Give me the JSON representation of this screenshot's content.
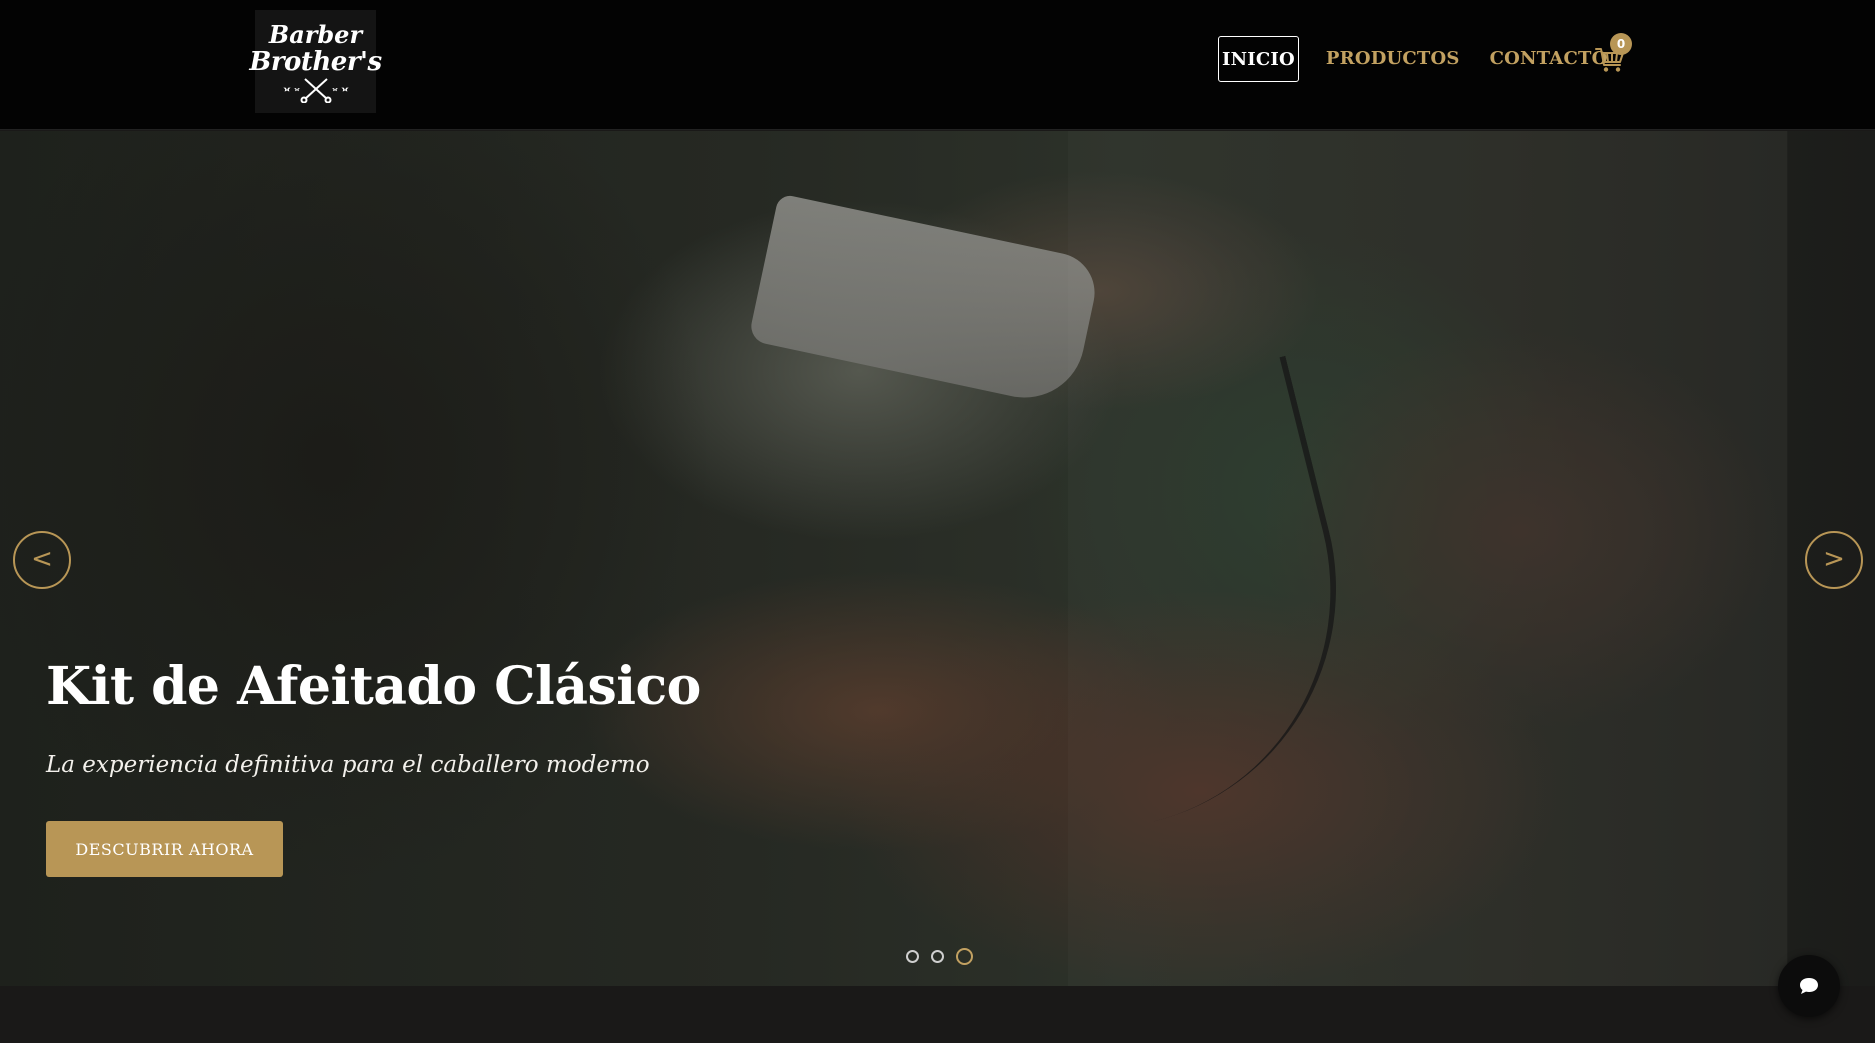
{
  "brand": {
    "line1": "Barber",
    "line2": "Brother's",
    "logo_icon": "crossed-scissors-icon"
  },
  "nav": {
    "items": [
      {
        "label": "INICIO",
        "active": true
      },
      {
        "label": "PRODUCTOS",
        "active": false
      },
      {
        "label": "CONTACTO",
        "active": false
      }
    ],
    "cart_icon": "shopping-cart-icon",
    "cart_count": "0"
  },
  "hero": {
    "title": "Kit de Afeitado Clásico",
    "subtitle": "La experiencia definitiva para el caballero moderno",
    "cta_label": "DESCUBRIR AHORA",
    "prev_label": "<",
    "next_label": ">",
    "slide_count": 3,
    "active_slide": 3
  },
  "chat": {
    "icon": "chat-bubble-icon"
  },
  "colors": {
    "accent": "#b89656",
    "header_bg": "#030303",
    "section_bg": "#1a1918"
  }
}
